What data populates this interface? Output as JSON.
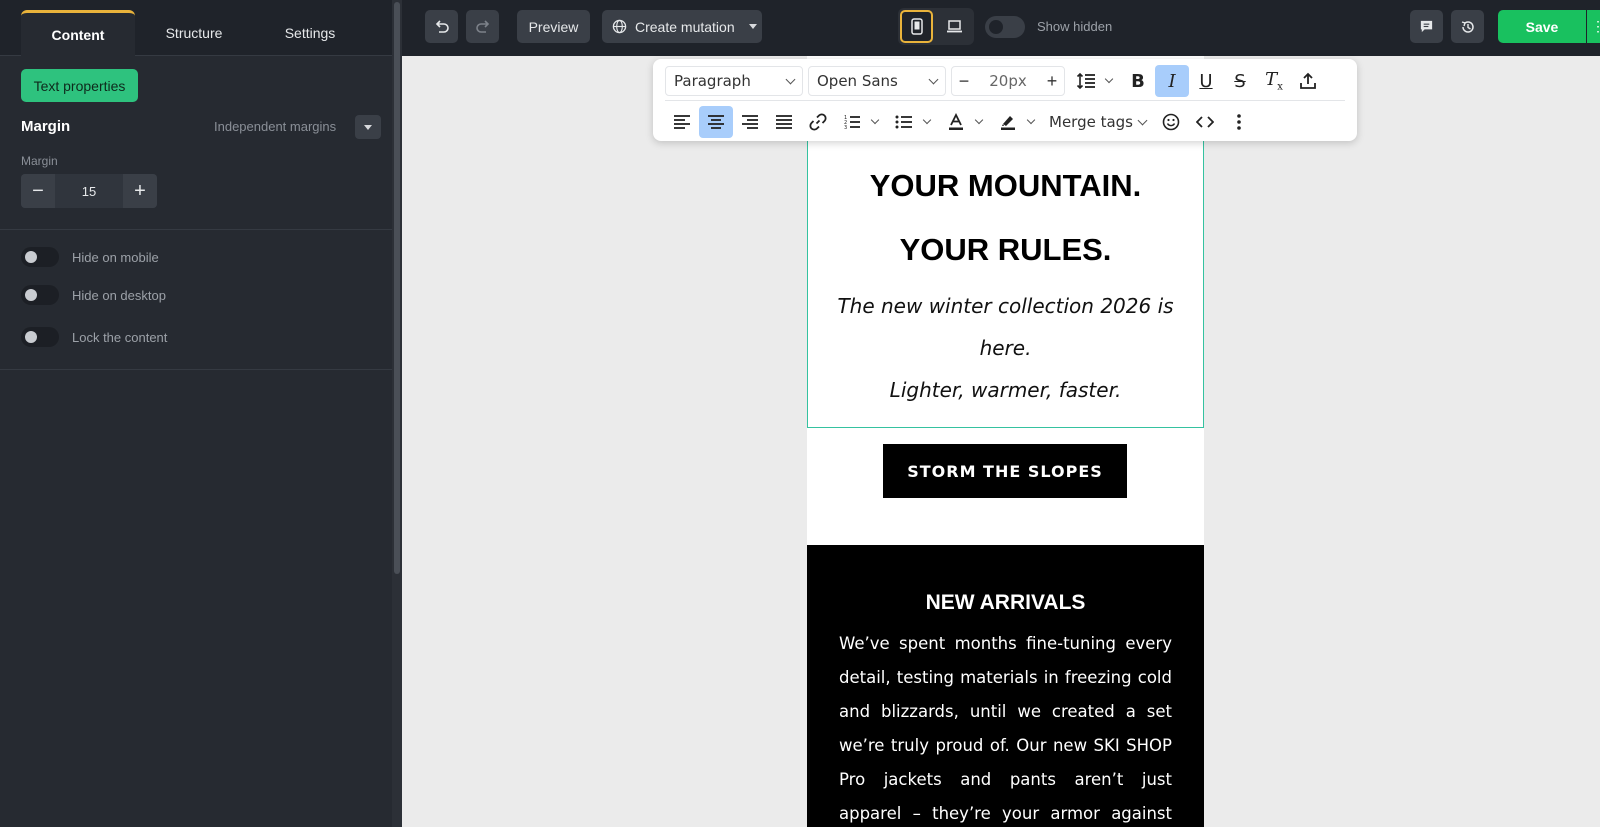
{
  "sidebar": {
    "tabs": [
      {
        "label": "Content",
        "active": true
      },
      {
        "label": "Structure",
        "active": false
      },
      {
        "label": "Settings",
        "active": false
      }
    ],
    "text_properties_label": "Text properties",
    "margin_heading": "Margin",
    "margin_mode": "Independent margins",
    "margin_sub_label": "Margin",
    "margin_value": "15",
    "toggles": [
      {
        "label": "Hide on mobile",
        "on": false
      },
      {
        "label": "Hide on desktop",
        "on": false
      },
      {
        "label": "Lock the content",
        "on": false
      }
    ]
  },
  "topbar": {
    "preview_label": "Preview",
    "create_mutation_label": "Create mutation",
    "show_hidden_label": "Show hidden",
    "show_hidden_on": false,
    "active_device": "mobile",
    "save_label": "Save"
  },
  "rte": {
    "block_type": "Paragraph",
    "font_family": "Open Sans",
    "font_size": "20px",
    "merge_tags_label": "Merge tags",
    "active_formats": [
      "italic",
      "align-center"
    ]
  },
  "email": {
    "headline_1": "YOUR MOUNTAIN.",
    "headline_2": "YOUR RULES.",
    "sub_line_1": "The new winter collection 2026 is",
    "sub_line_2": "here.",
    "sub_line_3": "Lighter, warmer, faster.",
    "cta_label": "STORM THE SLOPES",
    "section_title": "NEW ARRIVALS",
    "body_copy": "We’ve spent months fine-tuning every detail, testing materials in freezing cold and blizzards, until we created a set we’re truly proud of. Our new SKI SHOP Pro jackets and pants aren’t just apparel – they’re your armor against the elements."
  },
  "colors": {
    "accent_green": "#2ec27e",
    "save_green": "#19c15f",
    "active_tab_border": "#e9b33b",
    "selection_outline": "#35c2a0",
    "format_active_bg": "#a8cdfb"
  }
}
